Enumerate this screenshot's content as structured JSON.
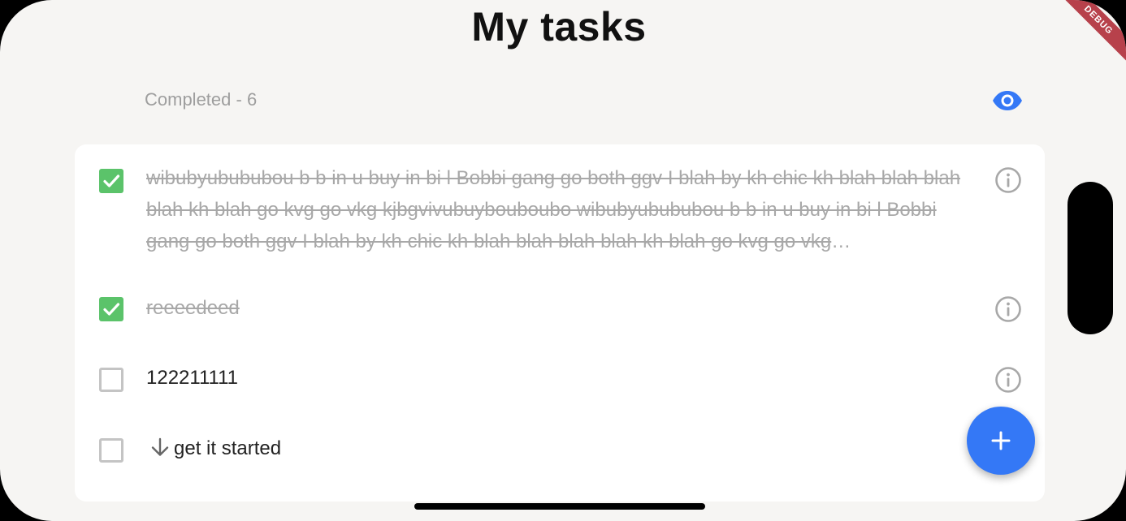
{
  "app": {
    "title": "My tasks",
    "debug_banner": "DEBUG"
  },
  "completed": {
    "label": "Completed - 6",
    "toggle_icon": "eye-icon"
  },
  "tasks": [
    {
      "text": "wibubyubububou b b in u buy in bi l Bobbi gang go both ggv I blah by kh chic kh blah blah blah blah kh blah go kvg go vkg kjbgvivubuybouboubo wibubyubububou b b in u buy in bi l Bobbi gang go both ggv I blah by kh chic kh blah blah blah blah kh blah go kvg go vkg kjbgvivubuybouboubo",
      "completed": true
    },
    {
      "text": "reeeedeed",
      "completed": true
    },
    {
      "text": "122211111",
      "completed": false
    },
    {
      "text": "get it started",
      "completed": false,
      "prefix_icon": "arrow-down-icon"
    }
  ],
  "fab": {
    "icon": "plus-icon"
  },
  "colors": {
    "accent": "#3478f6",
    "checked": "#5bc36a",
    "background": "#f6f5f3",
    "completed_text": "#a8a8a8",
    "debug": "#b7414b"
  }
}
